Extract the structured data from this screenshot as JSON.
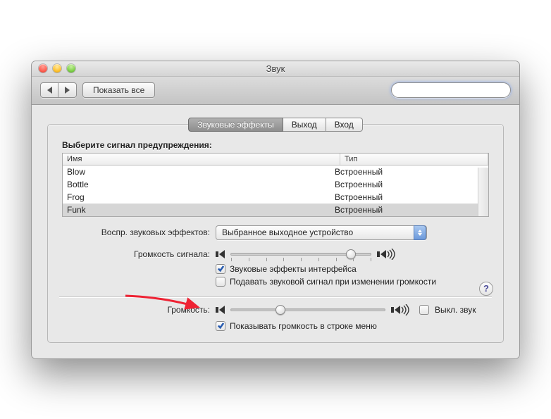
{
  "window": {
    "title": "Звук"
  },
  "toolbar": {
    "show_all": "Показать все",
    "search_placeholder": ""
  },
  "tabs": {
    "effects": "Звуковые эффекты",
    "output": "Выход",
    "input": "Вход"
  },
  "alerts": {
    "choose_label": "Выберите сигнал предупреждения:",
    "cols": {
      "name": "Имя",
      "type": "Тип"
    },
    "rows": [
      {
        "name": "Blow",
        "type": "Встроенный"
      },
      {
        "name": "Bottle",
        "type": "Встроенный"
      },
      {
        "name": "Frog",
        "type": "Встроенный"
      },
      {
        "name": "Funk",
        "type": "Встроенный"
      }
    ]
  },
  "play_through": {
    "label": "Воспр. звуковых эффектов:",
    "value": "Выбранное выходное устройство"
  },
  "alert_volume": {
    "label": "Громкость сигнала:"
  },
  "ui_effects": {
    "checked": true,
    "label": "Звуковые эффекты интерфейса"
  },
  "feedback": {
    "checked": false,
    "label": "Подавать звуковой сигнал при изменении громкости"
  },
  "output_volume": {
    "label": "Громкость:"
  },
  "mute": {
    "checked": false,
    "label": "Выкл. звук"
  },
  "menu_bar": {
    "checked": true,
    "label": "Показывать громкость в строке меню"
  },
  "help": "?"
}
